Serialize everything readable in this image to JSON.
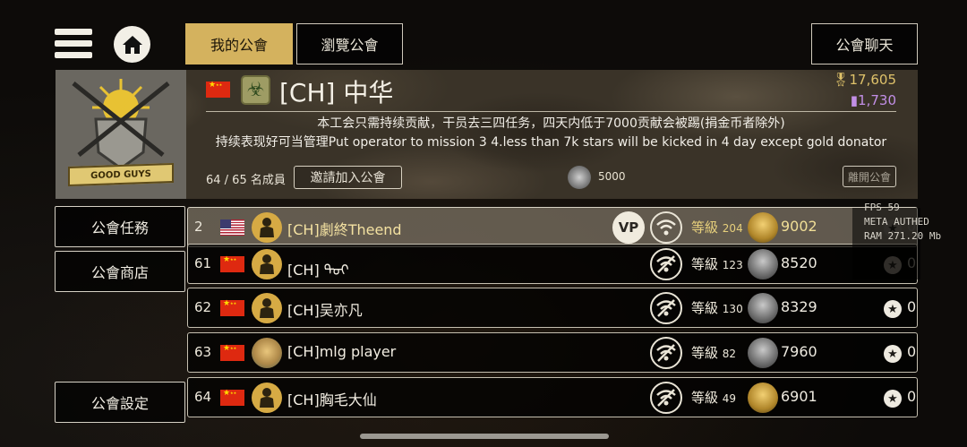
{
  "tabs": {
    "my_guild": "我的公會",
    "browse_guild": "瀏覽公會",
    "guild_chat": "公會聊天"
  },
  "guild": {
    "name": "[CH] 中华",
    "emblem_banner": "GOOD GUYS",
    "gold": "17,605",
    "gems": "1,730",
    "description_line1": "本工会只需持续贡献，干员去三四任务，四天内低于7000贡献会被踢(捐金币者除外)",
    "description_line2": "持续表现好可当管理Put operator to mission 3 4.less than 7k stars will be kicked in 4 day except gold donator",
    "members": "64 / 65 名成員",
    "invite_label": "邀請加入公會",
    "trophy_requirement": "5000",
    "leave_label": "離開公會"
  },
  "side_menu": {
    "missions": "公會任務",
    "shop": "公會商店",
    "settings": "公會設定"
  },
  "member_rows": [
    {
      "rank": "2",
      "flag": "us",
      "name": "[CH]劇終Theend",
      "vp": "VP",
      "level_label": "等級",
      "level": "204",
      "stars": "9002",
      "star_count": "0",
      "highlight": true
    },
    {
      "rank": "61",
      "flag": "cn",
      "name": "[CH]          ᠲᠣᠶ",
      "level_label": "等級",
      "level": "123",
      "stars": "8520",
      "star_count": "0"
    },
    {
      "rank": "62",
      "flag": "cn",
      "name": "[CH]吴亦凡",
      "level_label": "等級",
      "level": "130",
      "stars": "8329",
      "star_count": "0"
    },
    {
      "rank": "63",
      "flag": "cn",
      "name": "[CH]mlg player",
      "level_label": "等級",
      "level": "82",
      "stars": "7960",
      "star_count": "0"
    },
    {
      "rank": "64",
      "flag": "cn",
      "name": "[CH]胸毛大仙",
      "level_label": "等級",
      "level": "49",
      "stars": "6901",
      "star_count": "0"
    }
  ],
  "debug": {
    "fps": "FPS 59",
    "auth": "META AUTHED",
    "ram": "RAM 271.20 Mb"
  },
  "icons": {
    "menu": "hamburger-icon",
    "home": "home-icon",
    "hazard": "biohazard-icon",
    "wifi_on": "wifi-icon",
    "wifi_off": "wifi-off-icon",
    "star": "star-icon"
  },
  "colors": {
    "accent_gold": "#d4b25e",
    "gold_text": "#dfc26a",
    "gem_purple": "#c28fe6"
  }
}
